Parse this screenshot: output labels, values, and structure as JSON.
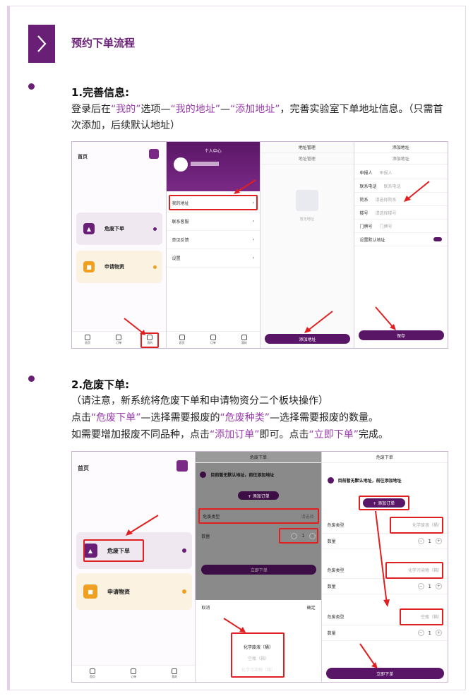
{
  "header": {
    "title": "预约下单流程"
  },
  "section1": {
    "title": "1.完善信息:",
    "p1_a": "登录后在",
    "p1_b": "“我的”",
    "p1_c": "选项—",
    "p1_d": "“我的地址”",
    "p1_e": "—",
    "p1_f": "“添加地址”",
    "p1_g": "，完善实验室下单地址信息。（只需首次添加，后续默认地址）"
  },
  "section2": {
    "title": "2.危废下单:",
    "line1": "（请注意，新系统将危废下单和申请物资分二个板块操作）",
    "l2_a": "点击",
    "l2_b": "“危废下单”",
    "l2_c": "—选择需要报废的",
    "l2_d": "“危废种类”",
    "l2_e": "—选择需要报废的数量。",
    "l3_a": "如需要增加报废不同品种，点击",
    "l3_b": "“添加订单”",
    "l3_c": "即可。点击",
    "l3_d": "“立即下单”",
    "l3_e": "完成。"
  },
  "shots1": {
    "home": {
      "title": "首页",
      "card1": "危废下单",
      "card2": "申请物资",
      "tabs": [
        "首页",
        "订单",
        "我的"
      ]
    },
    "profile": {
      "title": "个人中心",
      "items": [
        "我的地址",
        "联系客服",
        "意见反馈",
        "设置"
      ],
      "tabs": [
        "首页",
        "订单",
        "我的"
      ]
    },
    "addr_mgmt": {
      "title": "地址管理",
      "sub": "地址管理",
      "empty": "暂无地址",
      "button": "添加地址"
    },
    "add_addr": {
      "title": "添加地址",
      "sub": "添加地址",
      "fields": [
        {
          "label": "申报人",
          "ph": "申报人"
        },
        {
          "label": "联系电话",
          "ph": "联系电话"
        },
        {
          "label": "院系",
          "ph": "请选择院系"
        },
        {
          "label": "楼号",
          "ph": "请选择楼号"
        },
        {
          "label": "门牌号",
          "ph": "门牌号"
        }
      ],
      "default_label": "设置默认地址",
      "button": "保存"
    }
  },
  "shots2": {
    "home": {
      "title": "首页",
      "card1": "危废下单",
      "card2": "申请物资",
      "tabs": [
        "首页",
        "订单",
        "我的"
      ]
    },
    "order": {
      "title": "危废下单",
      "notice": "目前暂无默认地址，前往添加地址",
      "add_btn": "+ 添加订单",
      "type_label": "危废类型",
      "type_ph": "请选择",
      "qty_label": "数量",
      "qty": "1",
      "submit": "立即下单",
      "cancel": "取消",
      "confirm": "确定",
      "options": [
        "化学废液（桶）",
        "空瓶（箱）",
        "化学污染物（箱）"
      ]
    },
    "order2": {
      "title": "危废下单",
      "notice": "目前暂无默认地址，前往添加地址",
      "add_btn": "+ 添加订单",
      "rows": [
        {
          "label": "危废类型",
          "value": "化学废液（桶）",
          "qty_label": "数量",
          "qty": "1"
        },
        {
          "label": "危废类型",
          "value": "化学污染物（箱）",
          "qty_label": "数量",
          "qty": "1"
        },
        {
          "label": "危废类型",
          "value": "空瓶（箱）",
          "qty_label": "数量",
          "qty": "1"
        }
      ],
      "submit": "立即下单"
    }
  },
  "colors": {
    "primary": "#6a1f76",
    "highlight": "#9b3fae",
    "annotation": "#e02020"
  },
  "icons": [
    "chevron-right-icon",
    "home-icon",
    "order-icon",
    "user-icon",
    "location-icon"
  ]
}
